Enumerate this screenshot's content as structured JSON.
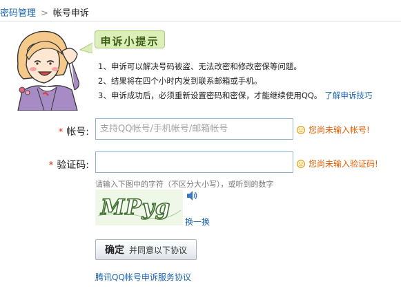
{
  "breadcrumb": {
    "parent": "密码管理",
    "separator": ">",
    "current": "帐号申诉"
  },
  "tips": {
    "title": "申诉小提示",
    "items": [
      "1、申诉可以解决号码被盗、无法改密和修改密保等问题。",
      "2、结果将在四个小时内发到联系邮箱或手机。",
      "3、申诉成功后，必须重新设置密码和密保，才能继续使用QQ。"
    ],
    "link": "了解申诉技巧"
  },
  "form": {
    "required_mark": "*",
    "account": {
      "label": "帐号:",
      "placeholder": "支持QQ帐号/手机帐号/邮箱帐号",
      "value": "",
      "warning": "您尚未输入帐号!"
    },
    "captcha": {
      "label": "验证码:",
      "value": "",
      "warning": "您尚未输入验证码!",
      "hint": "请输入下图中的字符（不区分大小写），或听到的数字",
      "image_text": "MPyg",
      "refresh": "换一换"
    },
    "submit": {
      "label": "确定",
      "sub_label": "并同意以下协议"
    },
    "agreement_link": "腾讯QQ帐号申诉服务协议"
  },
  "colors": {
    "link": "#1a66b3",
    "warning": "#e25c00",
    "required": "#d32b15",
    "tips_bg": "#dcefb8",
    "captcha_bg": "#eff8e8"
  },
  "icons": {
    "warning": "sad-face-icon",
    "audio": "speaker-icon"
  }
}
